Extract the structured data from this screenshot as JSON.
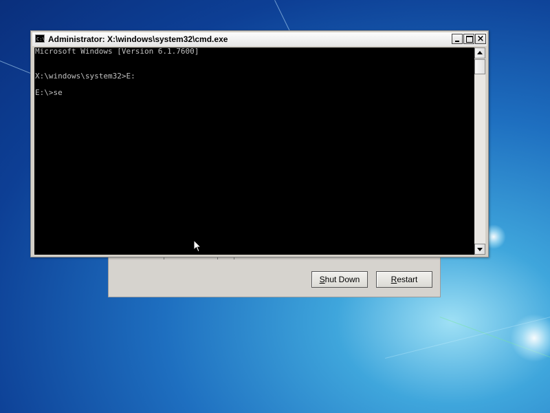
{
  "recovery_dialog": {
    "shutdown_label": "Shut Down",
    "restart_label": "Restart"
  },
  "cmd_window": {
    "title": "Administrator: X:\\windows\\system32\\cmd.exe",
    "icon_text": "C:\\.",
    "close_glyph": "×",
    "console_lines": [
      "Microsoft Windows [Version 6.1.7600]",
      "",
      "X:\\windows\\system32>E:",
      "",
      "E:\\>se"
    ]
  },
  "colors": {
    "console_bg": "#000000",
    "console_text": "#c0c0c0",
    "window_chrome": "#d4d0c8"
  }
}
